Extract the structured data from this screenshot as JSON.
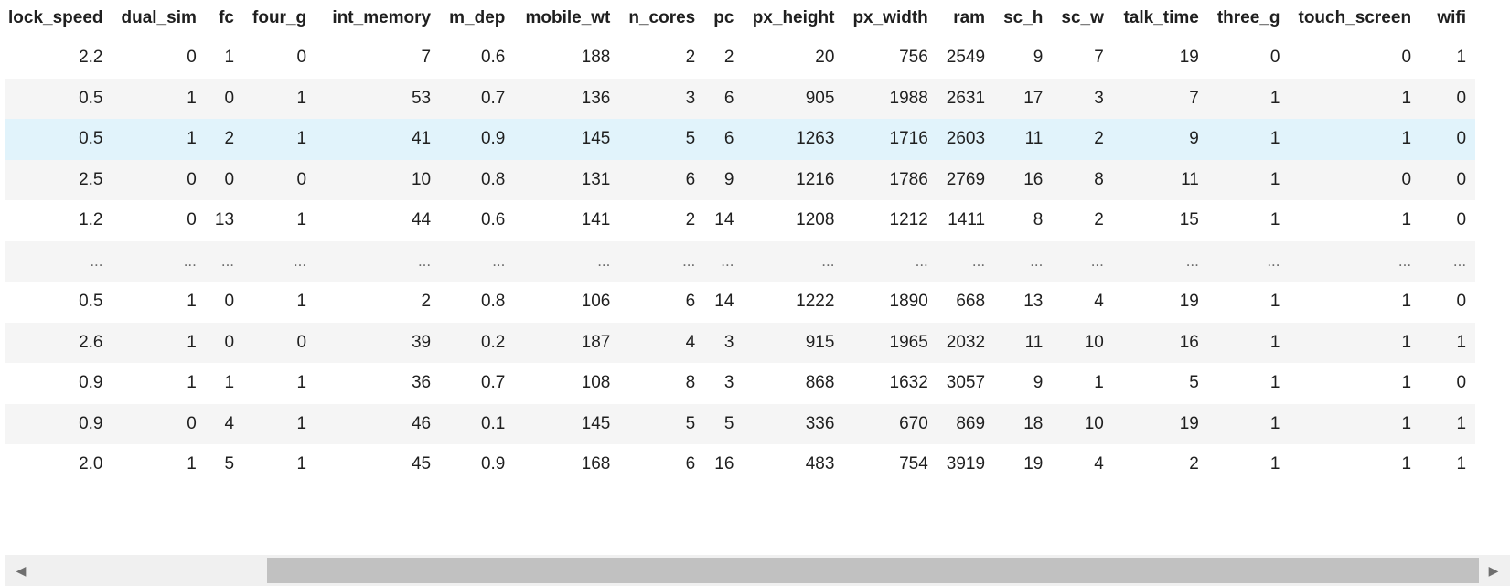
{
  "table": {
    "columns": [
      "lock_speed",
      "dual_sim",
      "fc",
      "four_g",
      "int_memory",
      "m_dep",
      "mobile_wt",
      "n_cores",
      "pc",
      "px_height",
      "px_width",
      "ram",
      "sc_h",
      "sc_w",
      "talk_time",
      "three_g",
      "touch_screen",
      "wifi"
    ],
    "rows": [
      [
        "2.2",
        "0",
        "1",
        "0",
        "7",
        "0.6",
        "188",
        "2",
        "2",
        "20",
        "756",
        "2549",
        "9",
        "7",
        "19",
        "0",
        "0",
        "1"
      ],
      [
        "0.5",
        "1",
        "0",
        "1",
        "53",
        "0.7",
        "136",
        "3",
        "6",
        "905",
        "1988",
        "2631",
        "17",
        "3",
        "7",
        "1",
        "1",
        "0"
      ],
      [
        "0.5",
        "1",
        "2",
        "1",
        "41",
        "0.9",
        "145",
        "5",
        "6",
        "1263",
        "1716",
        "2603",
        "11",
        "2",
        "9",
        "1",
        "1",
        "0"
      ],
      [
        "2.5",
        "0",
        "0",
        "0",
        "10",
        "0.8",
        "131",
        "6",
        "9",
        "1216",
        "1786",
        "2769",
        "16",
        "8",
        "11",
        "1",
        "0",
        "0"
      ],
      [
        "1.2",
        "0",
        "13",
        "1",
        "44",
        "0.6",
        "141",
        "2",
        "14",
        "1208",
        "1212",
        "1411",
        "8",
        "2",
        "15",
        "1",
        "1",
        "0"
      ],
      [
        "...",
        "...",
        "...",
        "...",
        "...",
        "...",
        "...",
        "...",
        "...",
        "...",
        "...",
        "...",
        "...",
        "...",
        "...",
        "...",
        "...",
        "..."
      ],
      [
        "0.5",
        "1",
        "0",
        "1",
        "2",
        "0.8",
        "106",
        "6",
        "14",
        "1222",
        "1890",
        "668",
        "13",
        "4",
        "19",
        "1",
        "1",
        "0"
      ],
      [
        "2.6",
        "1",
        "0",
        "0",
        "39",
        "0.2",
        "187",
        "4",
        "3",
        "915",
        "1965",
        "2032",
        "11",
        "10",
        "16",
        "1",
        "1",
        "1"
      ],
      [
        "0.9",
        "1",
        "1",
        "1",
        "36",
        "0.7",
        "108",
        "8",
        "3",
        "868",
        "1632",
        "3057",
        "9",
        "1",
        "5",
        "1",
        "1",
        "0"
      ],
      [
        "0.9",
        "0",
        "4",
        "1",
        "46",
        "0.1",
        "145",
        "5",
        "5",
        "336",
        "670",
        "869",
        "18",
        "10",
        "19",
        "1",
        "1",
        "1"
      ],
      [
        "2.0",
        "1",
        "5",
        "1",
        "45",
        "0.9",
        "168",
        "6",
        "16",
        "483",
        "754",
        "3919",
        "19",
        "4",
        "2",
        "1",
        "1",
        "1"
      ]
    ],
    "hovered_row_index": 2,
    "ellipsis_row_index": 5
  },
  "scrollbar": {
    "left_arrow_icon": "triangle-left-icon",
    "right_arrow_icon": "triangle-right-icon"
  }
}
